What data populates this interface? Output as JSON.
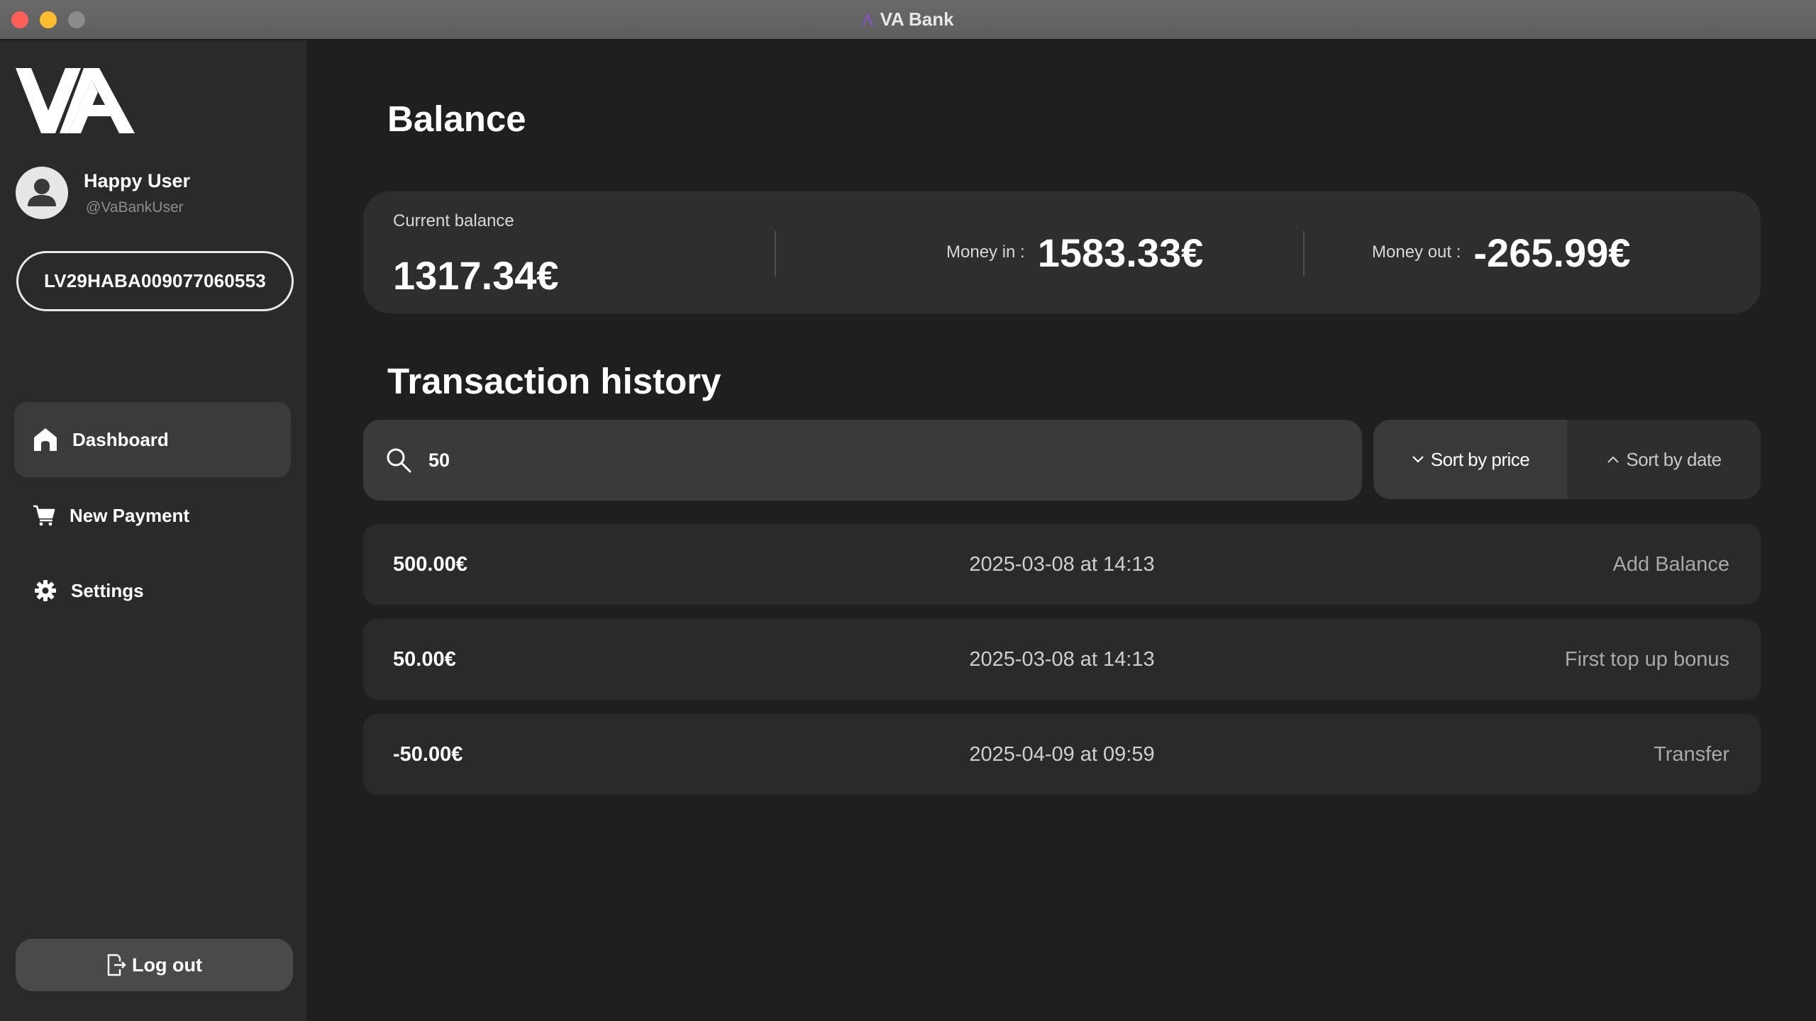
{
  "window": {
    "title": "VA Bank"
  },
  "sidebar": {
    "logo_text": "VA",
    "user": {
      "name": "Happy User",
      "handle": "@VaBankUser"
    },
    "account_number": "LV29HABA009077060553",
    "nav": [
      {
        "label": "Dashboard",
        "icon": "home-icon",
        "active": true
      },
      {
        "label": "New Payment",
        "icon": "cart-icon",
        "active": false
      },
      {
        "label": "Settings",
        "icon": "gear-icon",
        "active": false
      }
    ],
    "logout_label": "Log out"
  },
  "balance": {
    "heading": "Balance",
    "current_label": "Current balance",
    "current_value": "1317.34€",
    "money_in_label": "Money in :",
    "money_in_value": "1583.33€",
    "money_out_label": "Money out :",
    "money_out_value": "-265.99€"
  },
  "history": {
    "heading": "Transaction history",
    "search_value": "50",
    "sort_price_label": "Sort by price",
    "sort_date_label": "Sort by date",
    "transactions": [
      {
        "amount": "500.00€",
        "datetime": "2025-03-08 at 14:13",
        "description": "Add Balance"
      },
      {
        "amount": "50.00€",
        "datetime": "2025-03-08 at 14:13",
        "description": "First top up bonus"
      },
      {
        "amount": "-50.00€",
        "datetime": "2025-04-09 at 09:59",
        "description": "Transfer"
      }
    ]
  },
  "colors": {
    "background": "#1f1f1f",
    "sidebar": "#2a2a2a",
    "card": "#2e2e2e",
    "accent_title_logo": "#8a52c7"
  }
}
